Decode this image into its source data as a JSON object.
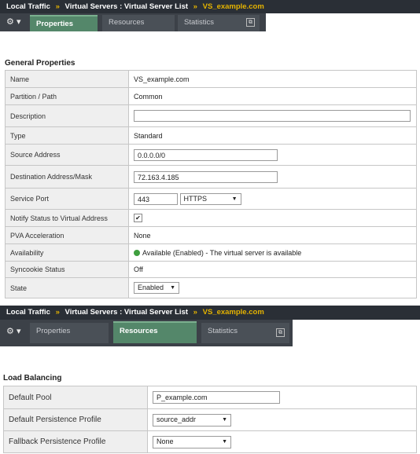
{
  "top": {
    "breadcrumb": [
      "Local Traffic",
      "Virtual Servers : Virtual Server List",
      "VS_example.com"
    ],
    "separator": "»",
    "tabs": [
      "Properties",
      "Resources",
      "Statistics"
    ]
  },
  "general": {
    "title": "General Properties",
    "name_label": "Name",
    "name_value": "VS_example.com",
    "partition_label": "Partition / Path",
    "partition_value": "Common",
    "description_label": "Description",
    "description_value": "",
    "type_label": "Type",
    "type_value": "Standard",
    "source_label": "Source Address",
    "source_value": "0.0.0.0/0",
    "dest_label": "Destination Address/Mask",
    "dest_value": "72.163.4.185",
    "port_label": "Service Port",
    "port_value": "443",
    "port_protocol": "HTTPS",
    "notify_label": "Notify Status to Virtual Address",
    "notify_checked": true,
    "pva_label": "PVA Acceleration",
    "pva_value": "None",
    "availability_label": "Availability",
    "availability_value": "Available (Enabled) - The virtual server is available",
    "syncookie_label": "Syncookie Status",
    "syncookie_value": "Off",
    "state_label": "State",
    "state_value": "Enabled"
  },
  "bottom": {
    "breadcrumb": [
      "Local Traffic",
      "Virtual Servers : Virtual Server List",
      "VS_example.com"
    ],
    "tabs": [
      "Properties",
      "Resources",
      "Statistics"
    ]
  },
  "lb": {
    "title": "Load Balancing",
    "pool_label": "Default Pool",
    "pool_value": "P_example.com",
    "persist_label": "Default Persistence Profile",
    "persist_value": "source_addr",
    "fallback_label": "Fallback Persistence Profile",
    "fallback_value": "None"
  },
  "colors": {
    "header_bg": "#2a2f36",
    "accent": "#e5b300",
    "active_tab": "#54876a",
    "available": "#3f9f3f"
  }
}
